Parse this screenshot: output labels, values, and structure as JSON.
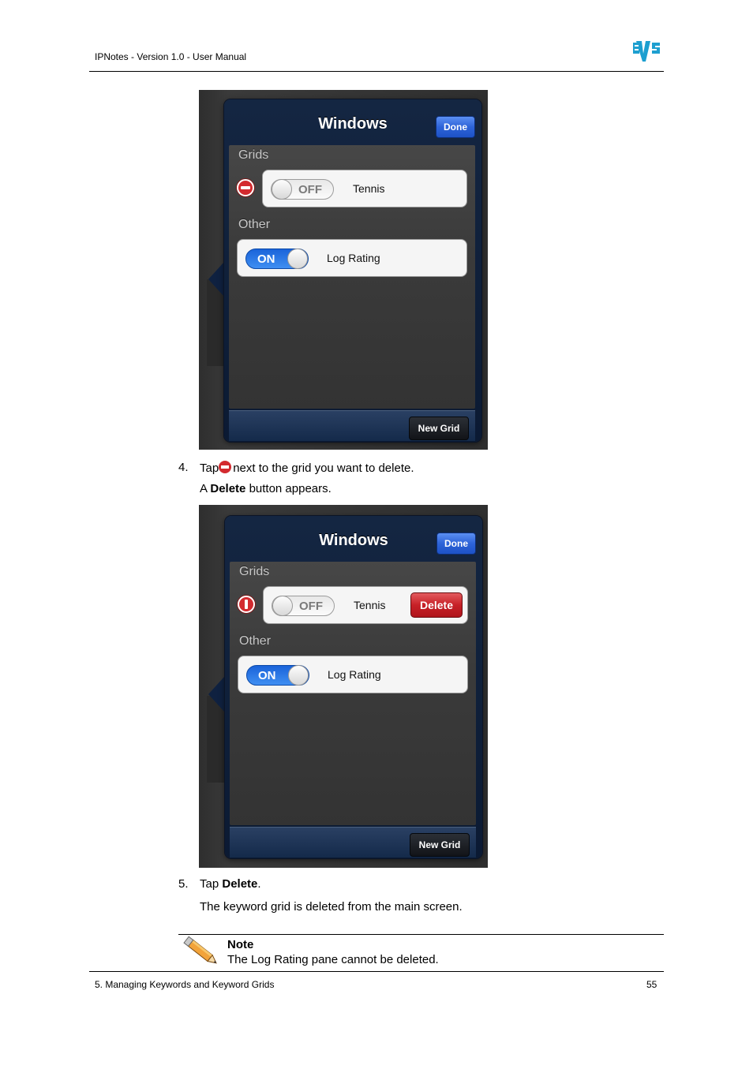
{
  "header": {
    "title": "IPNotes - Version 1.0 - User Manual",
    "logo_text": "EVS"
  },
  "footer": {
    "chapter": "5. Managing Keywords and Keyword Grids",
    "page": "55"
  },
  "screens": [
    {
      "title": "Windows",
      "done_label": "Done",
      "section1": "Grids",
      "row1_toggle": "OFF",
      "row1_label": "Tennis",
      "section2": "Other",
      "row2_toggle": "ON",
      "row2_label": "Log Rating",
      "new_grid_label": "New Grid"
    },
    {
      "title": "Windows",
      "done_label": "Done",
      "section1": "Grids",
      "row1_toggle": "OFF",
      "row1_label": "Tennis",
      "delete_label": "Delete",
      "section2": "Other",
      "row2_toggle": "ON",
      "row2_label": "Log Rating",
      "new_grid_label": "New Grid"
    }
  ],
  "steps": {
    "step4_number": "4.",
    "step4_text_before": "Tap",
    "step4_text_after": "next to the grid you want to delete.",
    "step4_result_prefix": "A",
    "step4_result_bold": "Delete",
    "step4_result_suffix": "button appears.",
    "step5_number": "5.",
    "step5_text": "Tap",
    "step5_bold": "Delete",
    "step5_period": ".",
    "step5_result": "The keyword grid is deleted from the main screen."
  },
  "note": {
    "title": "Note",
    "text": "The Log Rating pane cannot be deleted."
  }
}
